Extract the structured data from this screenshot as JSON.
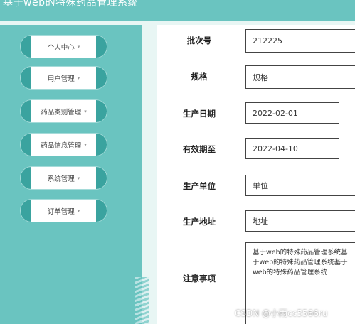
{
  "header": {
    "title": "基于web的特殊药品管理系统"
  },
  "sidebar": {
    "items": [
      {
        "label": "个人中心"
      },
      {
        "label": "用户管理"
      },
      {
        "label": "药品类别管理"
      },
      {
        "label": "药品信息管理"
      },
      {
        "label": "系统管理"
      },
      {
        "label": "订单管理"
      }
    ],
    "caret": "▾"
  },
  "form": {
    "batch_no": {
      "label": "批次号",
      "value": "212225"
    },
    "spec": {
      "label": "规格",
      "value": "规格"
    },
    "production_date": {
      "label": "生产日期",
      "value": "2022-02-01"
    },
    "expiry_date": {
      "label": "有效期至",
      "value": "2022-04-10"
    },
    "manufacturer": {
      "label": "生产单位",
      "value": "单位"
    },
    "address": {
      "label": "生产地址",
      "value": "地址"
    },
    "notes": {
      "label": "注意事项",
      "value": "基于web的特殊药品管理系统基于web的特殊药品管理系统基于web的特殊药品管理系统"
    }
  },
  "watermark": "CSDN @小雨cc5566ru",
  "colors": {
    "primary": "#6ac4c0",
    "accent": "#3aa39f",
    "background": "#ffffff"
  }
}
